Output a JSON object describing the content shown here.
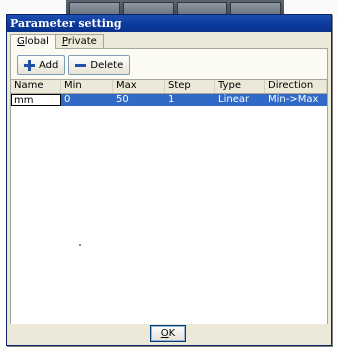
{
  "window": {
    "title": "Parameter setting"
  },
  "tabs": [
    {
      "label": "Global",
      "accel": "G",
      "rest": "lobal"
    },
    {
      "label": "Private",
      "accel": "P",
      "rest": "rivate"
    }
  ],
  "toolbar": {
    "add_label": "Add",
    "delete_label": "Delete"
  },
  "table": {
    "columns": [
      "Name",
      "Min",
      "Max",
      "Step",
      "Type",
      "Direction"
    ],
    "rows": [
      {
        "name": "mm",
        "min": "0",
        "max": "50",
        "step": "1",
        "type": "Linear",
        "direction": "Min->Max"
      }
    ]
  },
  "footer": {
    "ok_label": "OK",
    "ok_accel": "O",
    "ok_rest": "K"
  },
  "colors": {
    "titlebar": "#0b3a9c",
    "selection": "#3169c6",
    "window_bg": "#ece9d8"
  }
}
